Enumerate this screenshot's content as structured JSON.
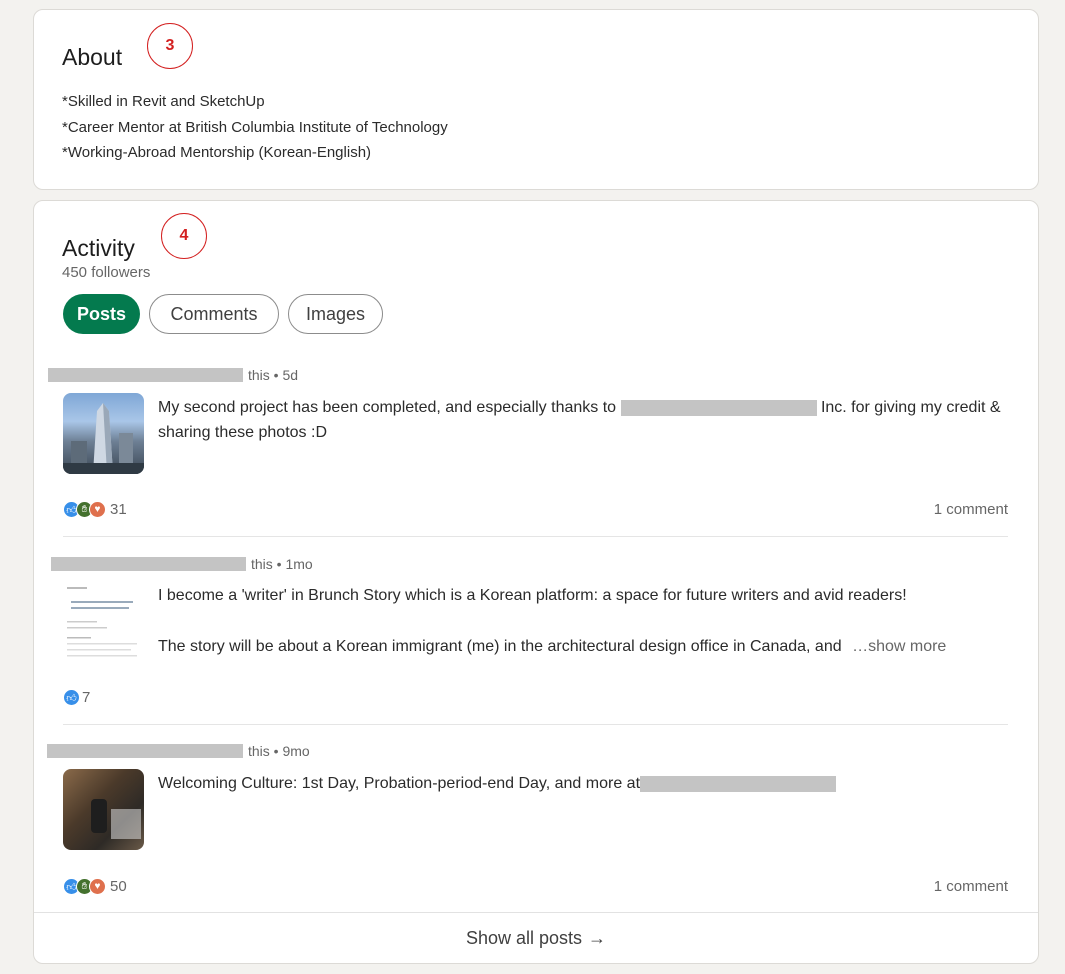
{
  "about": {
    "title": "About",
    "callout": "3",
    "lines": [
      "*Skilled in Revit and SketchUp",
      "*Career Mentor at British Columbia Institute of Technology",
      "*Working-Abroad Mentorship (Korean-English)"
    ]
  },
  "activity": {
    "title": "Activity",
    "callout": "4",
    "followers": "450 followers",
    "tabs": [
      {
        "label": "Posts",
        "active": true
      },
      {
        "label": "Comments",
        "active": false
      },
      {
        "label": "Images",
        "active": false
      }
    ],
    "posts": [
      {
        "meta": "this • 5d",
        "text_before": "My second project has been completed, and especially thanks to ",
        "text_after": " Inc. for giving my credit & sharing these photos :D",
        "reaction_count": "31",
        "comments": "1 comment"
      },
      {
        "meta": "this • 1mo",
        "text_line1": "I become a 'writer' in Brunch Story which is a Korean platform: a space for future writers and avid readers!",
        "text_line2": "The story will be about a Korean immigrant (me) in the architectural design office in Canada, and",
        "show_more": "…show more",
        "reaction_count": "7"
      },
      {
        "meta": "this • 9mo",
        "text_before": "Welcoming Culture: 1st Day, Probation-period-end Day, and more at",
        "reaction_count": "50",
        "comments": "1 comment"
      }
    ],
    "show_all": "Show all posts",
    "show_all_arrow": "→"
  },
  "colors": {
    "accent_green": "#047a4e",
    "callout_red": "#d32020",
    "like_blue": "#378fe9",
    "celebrate_green": "#44712e",
    "love_orange": "#df704d"
  }
}
